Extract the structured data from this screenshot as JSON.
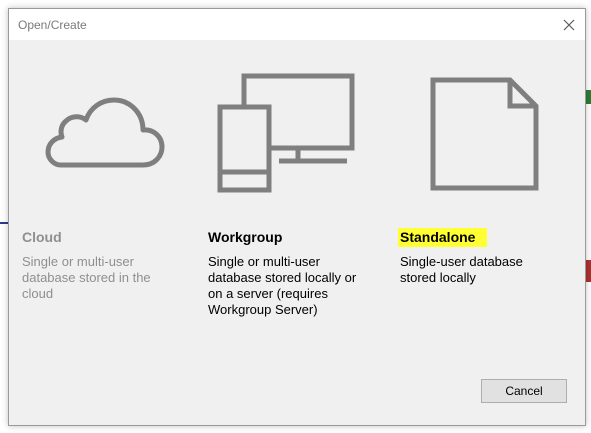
{
  "dialog": {
    "title": "Open/Create",
    "cancel_label": "Cancel"
  },
  "options": [
    {
      "title": "Cloud",
      "description": "Single or multi-user database stored in the cloud",
      "icon": "cloud-icon",
      "state": "disabled"
    },
    {
      "title": "Workgroup",
      "description": "Single or multi-user database stored locally or on a server (requires Workgroup Server)",
      "icon": "devices-icon",
      "state": "enabled"
    },
    {
      "title": "Standalone",
      "description": "Single-user database stored locally",
      "icon": "document-icon",
      "state": "enabled",
      "highlighted": true
    }
  ],
  "colors": {
    "dialog_bg": "#f0f0f0",
    "icon_gray": "#7f7f7f",
    "disabled_text": "#8f8f8f",
    "highlight": "#ffff33"
  }
}
